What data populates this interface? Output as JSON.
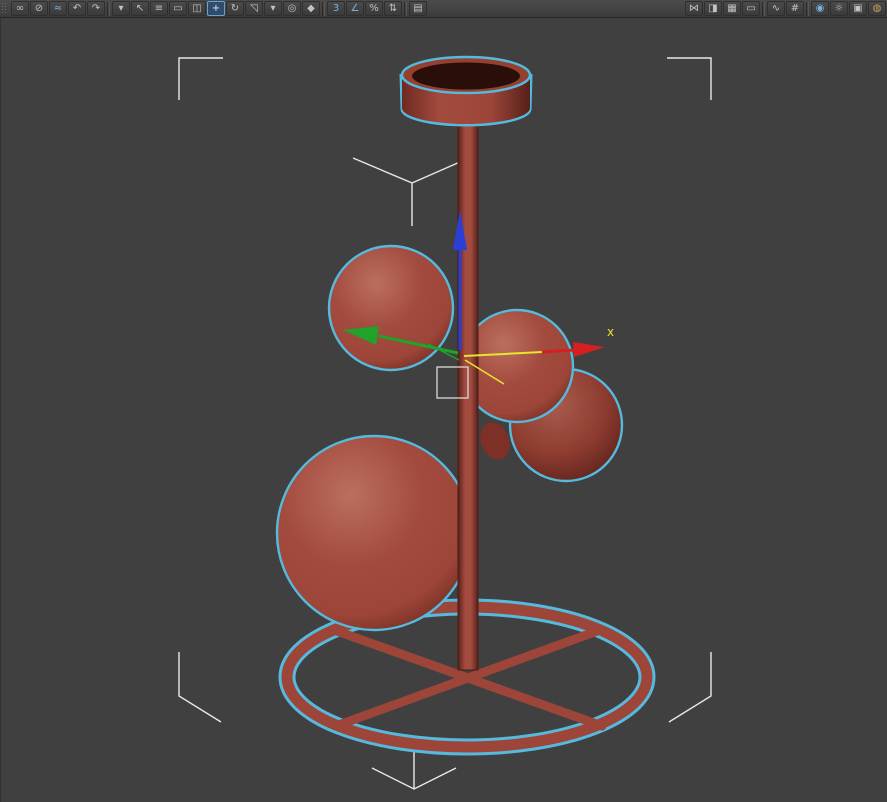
{
  "toolbar": {
    "left_items": [
      {
        "kind": "grip",
        "name": "toolbar-grip"
      },
      {
        "name": "select-and-link",
        "glyph": "∞"
      },
      {
        "name": "unlink-selection",
        "glyph": "⊘"
      },
      {
        "name": "bind-to-space-warp",
        "glyph": "≈",
        "tint": "blue"
      },
      {
        "name": "undo",
        "glyph": "↶"
      },
      {
        "name": "redo",
        "glyph": "↷"
      },
      {
        "kind": "sep"
      },
      {
        "name": "selection-filter",
        "glyph": "▾"
      },
      {
        "name": "select-object",
        "glyph": "↖"
      },
      {
        "name": "select-by-name",
        "glyph": "≡"
      },
      {
        "name": "rectangular-selection-region",
        "glyph": "▭"
      },
      {
        "name": "window-crossing-toggle",
        "glyph": "◫"
      },
      {
        "name": "select-and-move",
        "glyph": "+",
        "active": true
      },
      {
        "name": "select-and-rotate",
        "glyph": "↻"
      },
      {
        "name": "select-and-uniform-scale",
        "glyph": "◹"
      },
      {
        "name": "reference-coordinate-system",
        "glyph": "▾"
      },
      {
        "name": "use-pivot-point-center",
        "glyph": "◎"
      },
      {
        "name": "select-and-manipulate",
        "glyph": "◆"
      },
      {
        "kind": "sep"
      },
      {
        "name": "snaps-toggle",
        "glyph": "3",
        "tint": "blue"
      },
      {
        "name": "angle-snap-toggle",
        "glyph": "∠",
        "tint": "blue"
      },
      {
        "name": "percent-snap-toggle",
        "glyph": "%"
      },
      {
        "name": "spinner-snap-toggle",
        "glyph": "⇅"
      },
      {
        "kind": "sep"
      },
      {
        "name": "edit-named-selection-sets",
        "glyph": "▤"
      }
    ],
    "right_items": [
      {
        "name": "mirror",
        "glyph": "⋈"
      },
      {
        "name": "align",
        "glyph": "◨"
      },
      {
        "name": "layer-manager",
        "glyph": "▦"
      },
      {
        "name": "graphite-ribbon-toggle",
        "glyph": "▭"
      },
      {
        "kind": "sep"
      },
      {
        "name": "curve-editor",
        "glyph": "∿"
      },
      {
        "name": "schematic-view",
        "glyph": "#"
      },
      {
        "kind": "sep"
      },
      {
        "name": "material-editor",
        "glyph": "◉",
        "tint": "blue"
      },
      {
        "name": "render-setup",
        "glyph": "☼"
      },
      {
        "name": "rendered-frame-window",
        "glyph": "▣"
      },
      {
        "name": "render-production",
        "glyph": "◍",
        "tint": "warm"
      }
    ]
  },
  "viewport": {
    "gizmo_axis_label_x": "x"
  },
  "colors": {
    "toolbar-bg": "#3c3c3c",
    "viewport-bg": "#404040",
    "model-red": "#9c4538",
    "model-red-light": "#bb6f60",
    "model-red-mid": "#a34b3e",
    "model-red-dark": "#6e2a21",
    "model-red-deep": "#56201a",
    "cup-interior": "#2a0e0a",
    "selection-cyan": "#55bade",
    "bracket-white": "#e8e8e8",
    "gizmo-red": "#d42020",
    "gizmo-green": "#1fa32a",
    "gizmo-blue": "#2b3fd6",
    "gizmo-yellow": "#e6e62a"
  }
}
